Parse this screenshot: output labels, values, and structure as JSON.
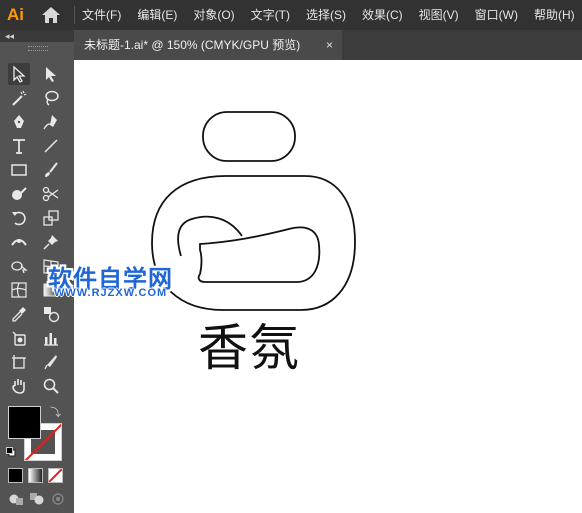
{
  "app": {
    "logo": "Ai"
  },
  "menu": {
    "items": [
      "文件(F)",
      "编辑(E)",
      "对象(O)",
      "文字(T)",
      "选择(S)",
      "效果(C)",
      "视图(V)",
      "窗口(W)",
      "帮助(H)"
    ]
  },
  "document_tab": {
    "title": "未标题-1.ai* @ 150% (CMYK/GPU 预览)",
    "close": "×"
  },
  "artwork": {
    "text": "香氛"
  },
  "watermark": {
    "title": "软件自学网",
    "url": "WWW.RJZXW.COM"
  },
  "colors": {
    "accent": "#ff9a00",
    "fill": "#000000",
    "stroke": "none",
    "watermark": "#1f66d6"
  },
  "tools": [
    "selection-tool",
    "direct-selection-tool",
    "magic-wand-tool",
    "lasso-tool",
    "pen-tool",
    "curvature-tool",
    "type-tool",
    "line-tool",
    "rectangle-tool",
    "paintbrush-tool",
    "shaper-tool",
    "scissors-tool",
    "rotate-tool",
    "scale-tool",
    "width-tool",
    "puppet-warp-tool",
    "shape-builder-tool",
    "perspective-grid-tool",
    "mesh-tool",
    "gradient-tool",
    "eyedropper-tool",
    "blend-tool",
    "symbol-sprayer-tool",
    "column-graph-tool",
    "artboard-tool",
    "slice-tool",
    "hand-tool",
    "zoom-tool"
  ]
}
